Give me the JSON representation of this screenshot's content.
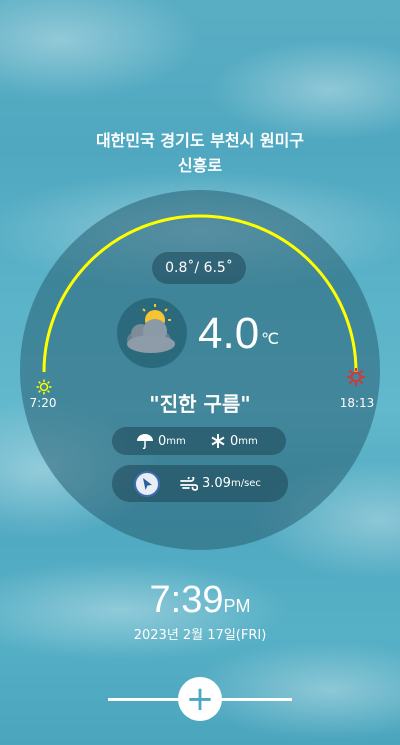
{
  "location": {
    "line1": "대한민국 경기도 부천시 원미구",
    "line2": "신흥로"
  },
  "weather": {
    "min_max": "0.8˚/ 6.5˚",
    "temperature": "4.0",
    "unit": "℃",
    "condition": "\"진한 구름\"",
    "icon": "cloudy-sun-icon"
  },
  "sun": {
    "sunrise": "7:20",
    "sunset": "18:13",
    "sunrise_icon": "sun-icon",
    "sunset_icon": "sunset-icon",
    "arc_color": "#ffff00"
  },
  "precipitation": {
    "rain_value": "0",
    "rain_unit": "mm",
    "snow_value": "0",
    "snow_unit": "mm"
  },
  "wind": {
    "speed": "3.09",
    "unit": "m/sec",
    "direction_icon": "navigation-arrow-icon"
  },
  "clock": {
    "time": "7:39",
    "ampm": "PM",
    "date": "2023년 2월 17일(FRI)"
  },
  "controls": {
    "add_symbol": "+"
  }
}
